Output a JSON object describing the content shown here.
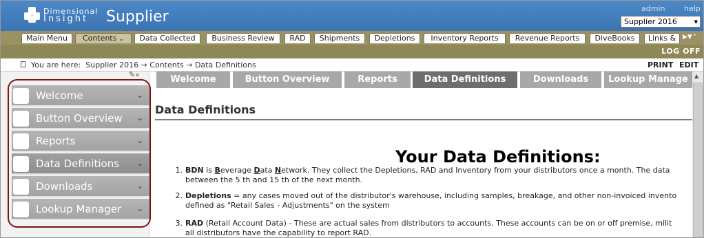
{
  "header": {
    "logo_top": "Dimensional",
    "logo_bottom": "Insight",
    "app_name": "Supplier",
    "admin_link": "admin",
    "help_link": "help",
    "supplier_selected": "Supplier 2016"
  },
  "tabs": [
    {
      "label": "Main Menu"
    },
    {
      "label": "Contents",
      "active": true
    },
    {
      "label": "Data Collected"
    },
    {
      "label": "Business Review"
    },
    {
      "label": "RAD"
    },
    {
      "label": "Shipments"
    },
    {
      "label": "Depletions"
    },
    {
      "label": "Inventory Reports"
    },
    {
      "label": "Revenue Reports"
    },
    {
      "label": "DiveBooks"
    },
    {
      "label": "Links &"
    }
  ],
  "logoff": "LOG OFF",
  "breadcrumb": {
    "prefix": "You are here:",
    "path": "Supplier 2016 → Contents → Data Definitions",
    "print": "PRINT",
    "edit": "EDIT"
  },
  "sidebar": {
    "items": [
      {
        "label": "Welcome"
      },
      {
        "label": "Button Overview"
      },
      {
        "label": "Reports"
      },
      {
        "label": "Data Definitions",
        "active": true
      },
      {
        "label": "Downloads"
      },
      {
        "label": "Lookup Manager"
      }
    ]
  },
  "content_tabs": [
    {
      "label": "Welcome"
    },
    {
      "label": "Button Overview"
    },
    {
      "label": "Reports"
    },
    {
      "label": "Data Definitions",
      "active": true
    },
    {
      "label": "Downloads"
    },
    {
      "label": "Lookup Manage"
    }
  ],
  "section_title": "Data Definitions",
  "main_title": "Your Data Definitions:",
  "definitions": [
    {
      "num": "1.",
      "term": "BDN",
      "line1_pre": " is ",
      "b1": "B",
      "mid1": "everage ",
      "b2": "D",
      "mid2": "ata ",
      "b3": "N",
      "line1_post": "etwork.  They collect the Depletions, RAD and Inventory from your distributors once a month.   The data",
      "line2": "between the 5 th and 15 th of the next month."
    },
    {
      "num": "2.",
      "term": "Depletions",
      "line1_post": " = any cases moved out of the distributor's warehouse, including samples, breakage, and other non-invoiced invento",
      "line2": "defined as \"Retail Sales - Adjustments\" on the system"
    },
    {
      "num": "3.",
      "term": "RAD",
      "line1_post": " (Retail Account Data) - These are actual sales from distributors to accounts.  These accounts can be on or off premise, milit",
      "line2": "all distributors have the capability to report RAD."
    }
  ],
  "colors": {
    "header_blue": "#3f7bbb",
    "tab_bar": "#9a9264",
    "logoff_bar": "#8e8757",
    "sidebar_item": "#ababab",
    "sidebar_active": "#949494",
    "content_tab": "#a8a8a8",
    "content_tab_active": "#6e6e6e",
    "highlight_border": "#7a1616"
  }
}
